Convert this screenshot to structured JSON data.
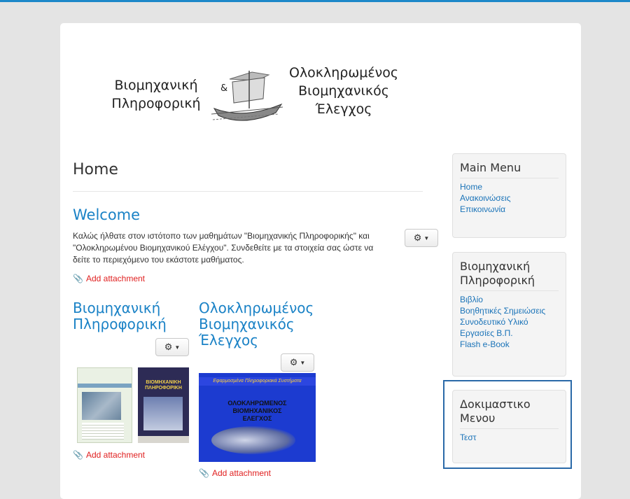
{
  "header": {
    "logo_left_line1": "Βιομηχανική",
    "logo_left_line2": "Πληροφορική",
    "logo_amp": "&",
    "logo_right_line1": "Ολοκληρωμένος",
    "logo_right_line2": "Βιομηχανικός",
    "logo_right_line3": "Έλεγχος"
  },
  "main": {
    "page_title": "Home",
    "welcome": {
      "title": "Welcome",
      "text": "Καλώς ήλθατε στον ιστότοπο των μαθημάτων \"Βιομηχανικής Πληροφορικής\" και \"Ολοκληρωμένου Βιομηχανικού Ελέγχου\". Συνδεθείτε με τα στοιχεία σας ώστε να δείτε το περιεχόμενο του εκάστοτε μαθήματος.",
      "attachment": "Add attachment"
    },
    "articles": [
      {
        "title_line1": "Βιομηχανική",
        "title_line2": "Πληροφορική",
        "attachment": "Add attachment"
      },
      {
        "title_line1": "Ολοκληρωμένος",
        "title_line2": "Βιομηχανικός",
        "title_line3": "Έλεγχος",
        "attachment": "Add attachment"
      }
    ],
    "images": {
      "bp_cover_title": "ΒΙΟΜΗΧΑΝΙΚΗ ΠΛΗΡΟΦΟΡΙΚΗ",
      "oe_top": "Εφαρμοσμένα Πληροφοριακά Συστήματα",
      "oe_mid1": "ΟΛΟΚΛΗΡΩΜΕΝΟΣ",
      "oe_mid2": "ΒΙΟΜΗΧΑΝΙΚΟΣ",
      "oe_mid3": "ΕΛΕΓΧΟΣ"
    }
  },
  "sidebar": {
    "modules": [
      {
        "title": "Main Menu",
        "items": [
          "Home",
          "Ανακοινώσεις",
          "Επικοινωνία"
        ]
      },
      {
        "title": "Βιομηχανική Πληροφορική",
        "items": [
          "Βιβλίο",
          "Βοηθητικές Σημειώσεις",
          "Συνοδευτικό Υλικό",
          "Εργασίες Β.Π.",
          "Flash e-Book"
        ]
      },
      {
        "title": "Δοκιμαστικο Μενου",
        "items": [
          "Τεστ"
        ]
      }
    ]
  },
  "colors": {
    "link": "#1a73b8",
    "heading_link": "#1a82c6",
    "attachment": "#e02020",
    "top_bar": "#1d88c9",
    "highlight_border": "#2a69a8"
  }
}
